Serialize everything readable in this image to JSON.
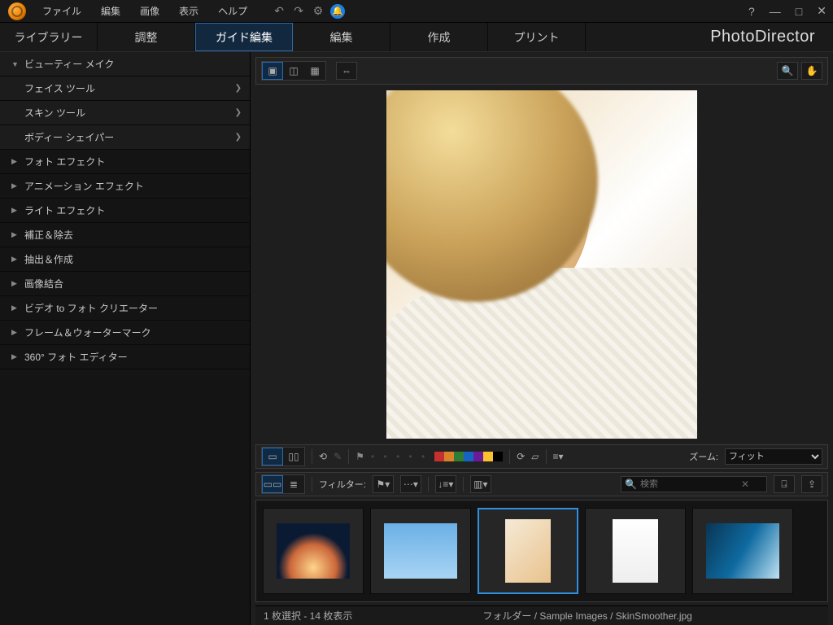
{
  "menu": {
    "file": "ファイル",
    "edit": "編集",
    "image": "画像",
    "view": "表示",
    "help": "ヘルプ"
  },
  "brand": "PhotoDirector",
  "tabs": {
    "library": "ライブラリー",
    "adjust": "調整",
    "guided": "ガイド編集",
    "edit": "編集",
    "create": "作成",
    "print": "プリント"
  },
  "sidebar": {
    "beauty": "ビューティー メイク",
    "face": "フェイス ツール",
    "skin": "スキン ツール",
    "body": "ボディー シェイパー",
    "photoFx": "フォト エフェクト",
    "anim": "アニメーション エフェクト",
    "light": "ライト エフェクト",
    "correct": "補正＆除去",
    "extract": "抽出＆作成",
    "merge": "画像結合",
    "v2p": "ビデオ to フォト クリエーター",
    "frame": "フレーム＆ウォーターマーク",
    "pano": "360° フォト エディター"
  },
  "toolbar": {
    "filterLabel": "フィルター:",
    "zoomLabel": "ズーム:",
    "zoomValue": "フィット",
    "searchPlaceholder": "検索"
  },
  "swatches": [
    "#c53030",
    "#d9822b",
    "#2f7d32",
    "#1565c0",
    "#6a1b9a",
    "#fbc02d",
    "#000000"
  ],
  "status": {
    "selection": "1 枚選択 - 14 枚表示",
    "pathLabel": "フォルダー",
    "folder": "Sample Images",
    "file": "SkinSmoother.jpg"
  }
}
